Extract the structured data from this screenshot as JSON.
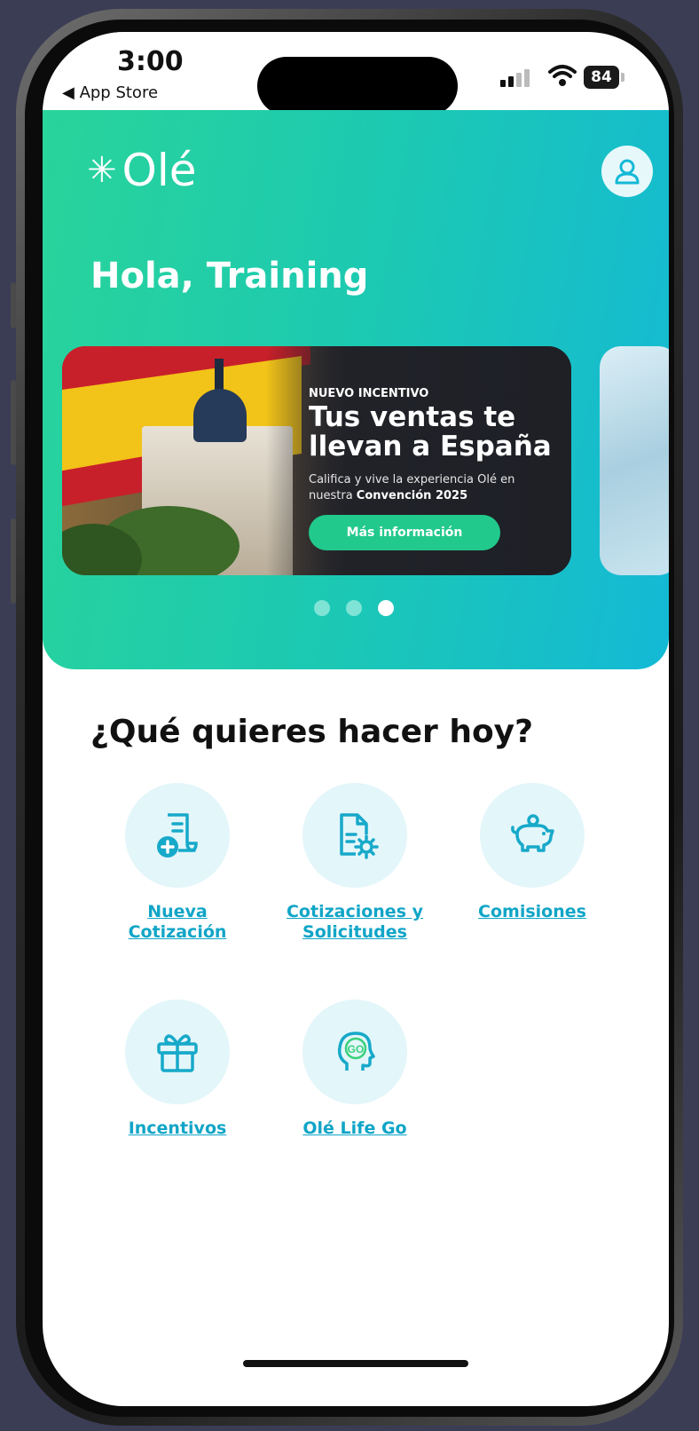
{
  "status_bar": {
    "time": "3:00",
    "back_label": "◀ App Store",
    "battery": "84"
  },
  "header": {
    "logo_text": "Olé",
    "greeting": "Hola, Training"
  },
  "banner": {
    "kicker": "NUEVO INCENTIVO",
    "title": "Tus ventas te llevan a España",
    "description_prefix": "Califica y vive la experiencia Olé en nuestra ",
    "description_bold": "Convención 2025",
    "button_label": "Más información"
  },
  "carousel": {
    "page_count": 3,
    "active_index": 2
  },
  "section": {
    "title": "¿Qué quieres hacer hoy?"
  },
  "actions": [
    {
      "label_line1": "Nueva",
      "label_line2": "Cotización",
      "icon": "new-quote-icon"
    },
    {
      "label_line1": "Cotizaciones y",
      "label_line2": "Solicitudes",
      "icon": "document-settings-icon"
    },
    {
      "label_line1": "Comisiones",
      "label_line2": "",
      "icon": "piggy-bank-icon"
    },
    {
      "label_line1": "Incentivos",
      "label_line2": "",
      "icon": "gift-icon"
    },
    {
      "label_line1": "Olé Life Go",
      "label_line2": "",
      "icon": "head-go-icon"
    }
  ],
  "colors": {
    "hero_gradient_start": "#29d49a",
    "hero_gradient_end": "#14b9d6",
    "link": "#10a5c7",
    "icon_circle": "#e3f6fa",
    "cta_button": "#22c98c"
  }
}
